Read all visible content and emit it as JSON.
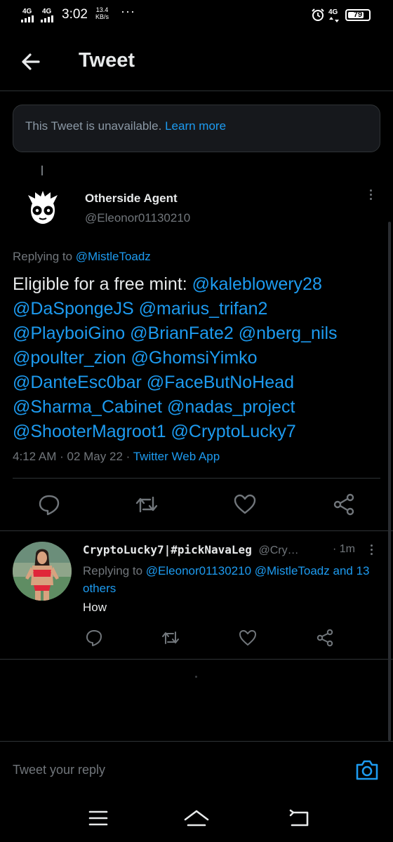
{
  "status_bar": {
    "signal1": "4G",
    "signal2": "4G",
    "time": "3:02",
    "speed_value": "13.4",
    "speed_unit": "KB/s",
    "overflow": "···",
    "network_right": "4G",
    "battery": "79",
    "battery_level": 0.79
  },
  "header": {
    "title": "Tweet"
  },
  "unavailable": {
    "text": "This Tweet is unavailable.",
    "link": "Learn more"
  },
  "main_tweet": {
    "author_name": "Otherside Agent",
    "author_handle": "@Eleonor01130210",
    "replying_label": "Replying to",
    "replying_to": "@MistleToadz",
    "body_text": "Eligible for a free mint: ",
    "mentions": [
      "@kaleblowery28",
      "@DaSpongeJS",
      "@marius_trifan2",
      "@PlayboiGino",
      "@BrianFate2",
      "@nberg_nils",
      "@poulter_zion",
      "@GhomsiYimko",
      "@DanteEsc0bar",
      "@FaceButNoHead",
      "@Sharma_Cabinet",
      "@nadas_project",
      "@ShooterMagroot1",
      "@CryptoLucky7"
    ],
    "time": "4:12 AM",
    "dot": "·",
    "date": "02 May 22",
    "source": "Twitter Web App"
  },
  "reply": {
    "name": "CryptoLucky7|#pickNavaLeg",
    "handle": "@Cry…",
    "time": "· 1m",
    "replying_label": "Replying to",
    "replying_to": "@Eleonor01130210 @MistleToadz and 13 others",
    "text": "How"
  },
  "composer": {
    "placeholder": "Tweet your reply"
  },
  "icons": {
    "back": "arrow-left-icon",
    "more": "more-vertical-icon",
    "reply": "comment-icon",
    "retweet": "retweet-icon",
    "like": "heart-icon",
    "share": "share-icon",
    "camera": "camera-icon"
  },
  "colors": {
    "accent": "#1d9bf0",
    "background": "#000000",
    "muted": "#71767b",
    "divider": "#2f3336"
  }
}
